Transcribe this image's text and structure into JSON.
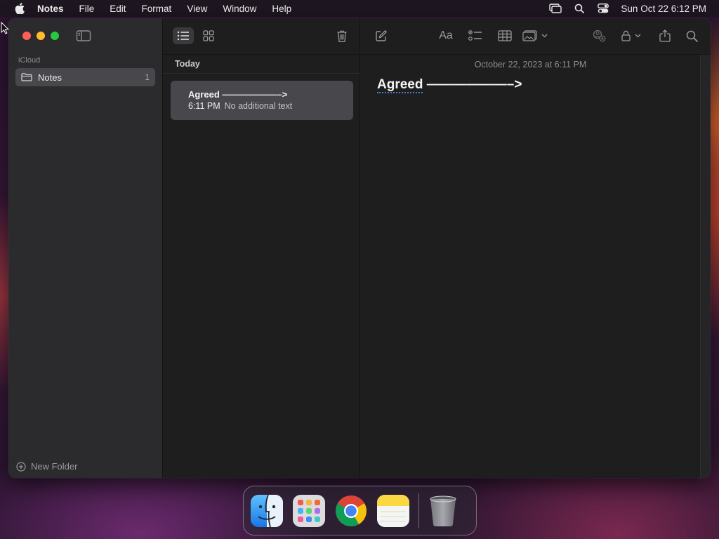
{
  "menubar": {
    "app_name": "Notes",
    "items": [
      "File",
      "Edit",
      "Format",
      "View",
      "Window",
      "Help"
    ],
    "clock": "Sun Oct 22  6:12 PM"
  },
  "sidebar": {
    "section_label": "iCloud",
    "folders": [
      {
        "label": "Notes",
        "count": "1"
      }
    ],
    "new_folder_label": "New Folder"
  },
  "notelist": {
    "group_header": "Today",
    "notes": [
      {
        "title": "Agreed ——————–>",
        "time": "6:11 PM",
        "preview": "No additional text"
      }
    ]
  },
  "editor": {
    "date_line": "October 22, 2023 at 6:11 PM",
    "body_first_word": "Agreed",
    "body_rest": " ——————–>"
  },
  "dock": {
    "apps": [
      "Finder",
      "Launchpad",
      "Google Chrome",
      "Notes",
      "Trash"
    ]
  },
  "colors": {
    "selection": "#48474b",
    "traffic_close": "#ff5f57",
    "traffic_minimize": "#febc2e",
    "traffic_maximize": "#28c840",
    "spellcheck_underline": "#4a7bd6"
  }
}
